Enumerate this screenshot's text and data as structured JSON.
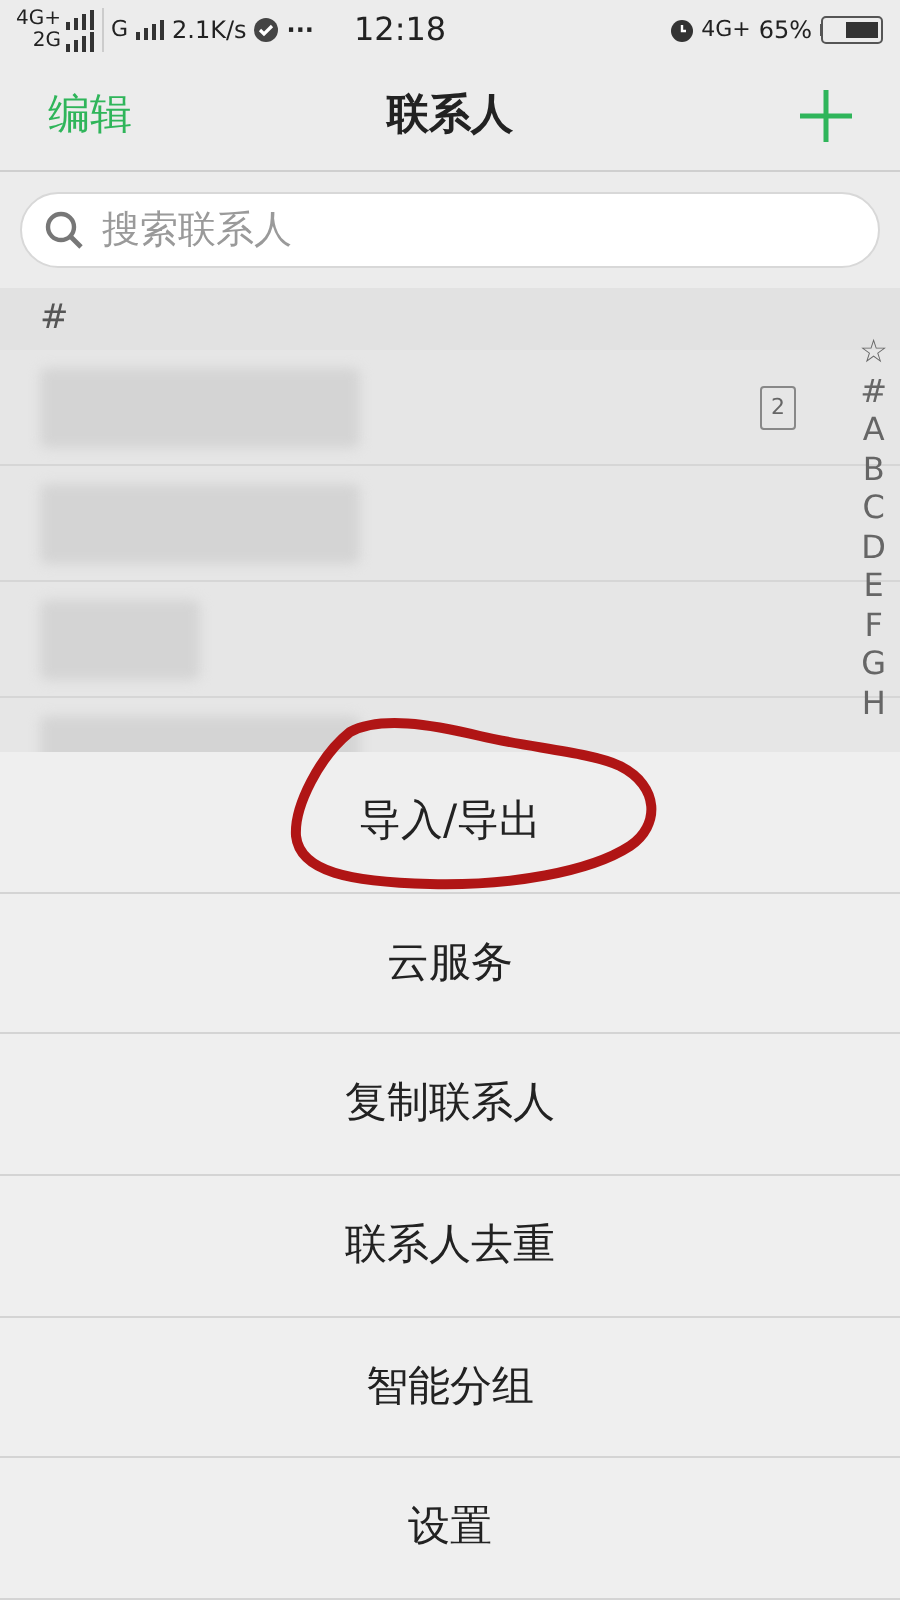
{
  "status_bar": {
    "signal_top": "4G+",
    "signal_bottom": "2G",
    "network": "G",
    "speed": "2.1K/s",
    "more": "···",
    "time": "12:18",
    "mobile_data": "4G+",
    "battery": "65%"
  },
  "header": {
    "edit": "编辑",
    "title": "联系人"
  },
  "search": {
    "placeholder": "搜索联系人"
  },
  "section": "#",
  "rows": [
    {
      "kind": "blurred",
      "sim_badge": "2"
    },
    {
      "kind": "blurred"
    },
    {
      "kind": "blurred"
    },
    {
      "kind": "blurred"
    }
  ],
  "index": [
    "☆",
    "#",
    "A",
    "B",
    "C",
    "D",
    "E",
    "F",
    "G",
    "H"
  ],
  "menu": [
    {
      "label": "导入/导出",
      "circled": true
    },
    {
      "label": "云服务",
      "circled": false
    },
    {
      "label": "复制联系人",
      "circled": false
    },
    {
      "label": "联系人去重",
      "circled": false
    },
    {
      "label": "智能分组",
      "circled": false
    },
    {
      "label": "设置",
      "circled": false
    }
  ]
}
